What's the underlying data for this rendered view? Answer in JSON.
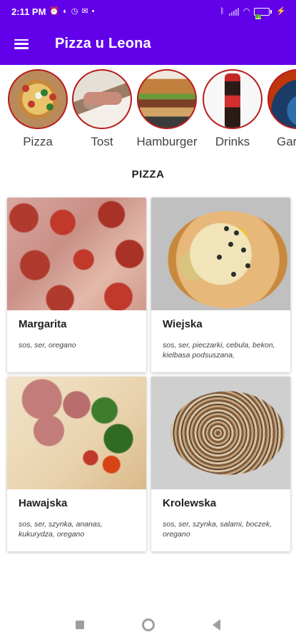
{
  "status_bar": {
    "time": "2:11 PM",
    "left_icons": [
      "alarm-icon",
      "data-saver-icon",
      "clock-icon",
      "mail-icon"
    ],
    "battery_level": 0.85,
    "battery_label": "85"
  },
  "app_bar": {
    "title": "Pizza u Leona",
    "menu_icon": "hamburger-menu-icon",
    "background": "#6200ea"
  },
  "categories": [
    {
      "label": "Pizza",
      "thumb": "pizza"
    },
    {
      "label": "Tost",
      "thumb": "tost"
    },
    {
      "label": "Hamburger",
      "thumb": "burger"
    },
    {
      "label": "Drinks",
      "thumb": "drinks"
    },
    {
      "label": "Gar",
      "thumb": "garnish"
    }
  ],
  "section_title": "PIZZA",
  "products": [
    {
      "name": "Margarita",
      "description": "sos, ser, oregano"
    },
    {
      "name": "Wiejska",
      "description": "sos, ser, pieczarki, cebula, bekon, kielbasa podsuszana,"
    },
    {
      "name": "Hawajska",
      "description": "sos, ser, szynka, ananas, kukurydza, oregano"
    },
    {
      "name": "Krolewska",
      "description": "sos, ser, szynka, salami, boczek, oregano"
    }
  ],
  "nav_bar": {
    "buttons": [
      "recents-icon",
      "home-icon",
      "back-icon"
    ]
  },
  "colors": {
    "primary": "#6200ea",
    "category_ring": "#b71c1c"
  }
}
